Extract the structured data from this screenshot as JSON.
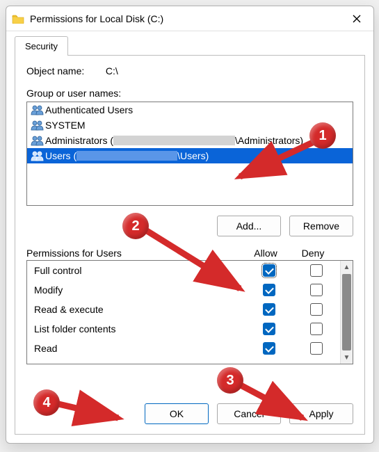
{
  "titlebar": {
    "title": "Permissions for Local Disk (C:)"
  },
  "tabs": {
    "security": "Security"
  },
  "object": {
    "label": "Object name:",
    "value": "C:\\"
  },
  "groups": {
    "label": "Group or user names:",
    "items": [
      {
        "text": "Authenticated Users"
      },
      {
        "text": "SYSTEM"
      },
      {
        "prefix": "Administrators (",
        "suffix": "\\Administrators)"
      },
      {
        "prefix": "Users (",
        "suffix": "\\Users)"
      }
    ]
  },
  "buttons": {
    "add": "Add...",
    "remove": "Remove",
    "ok": "OK",
    "cancel": "Cancel",
    "apply": "Apply"
  },
  "permHeader": {
    "title": "Permissions for Users",
    "allow": "Allow",
    "deny": "Deny"
  },
  "permissions": [
    {
      "name": "Full control",
      "allow": true,
      "deny": false,
      "focus": true
    },
    {
      "name": "Modify",
      "allow": true,
      "deny": false
    },
    {
      "name": "Read & execute",
      "allow": true,
      "deny": false
    },
    {
      "name": "List folder contents",
      "allow": true,
      "deny": false
    },
    {
      "name": "Read",
      "allow": true,
      "deny": false
    }
  ],
  "annotations": {
    "1": "1",
    "2": "2",
    "3": "3",
    "4": "4"
  }
}
